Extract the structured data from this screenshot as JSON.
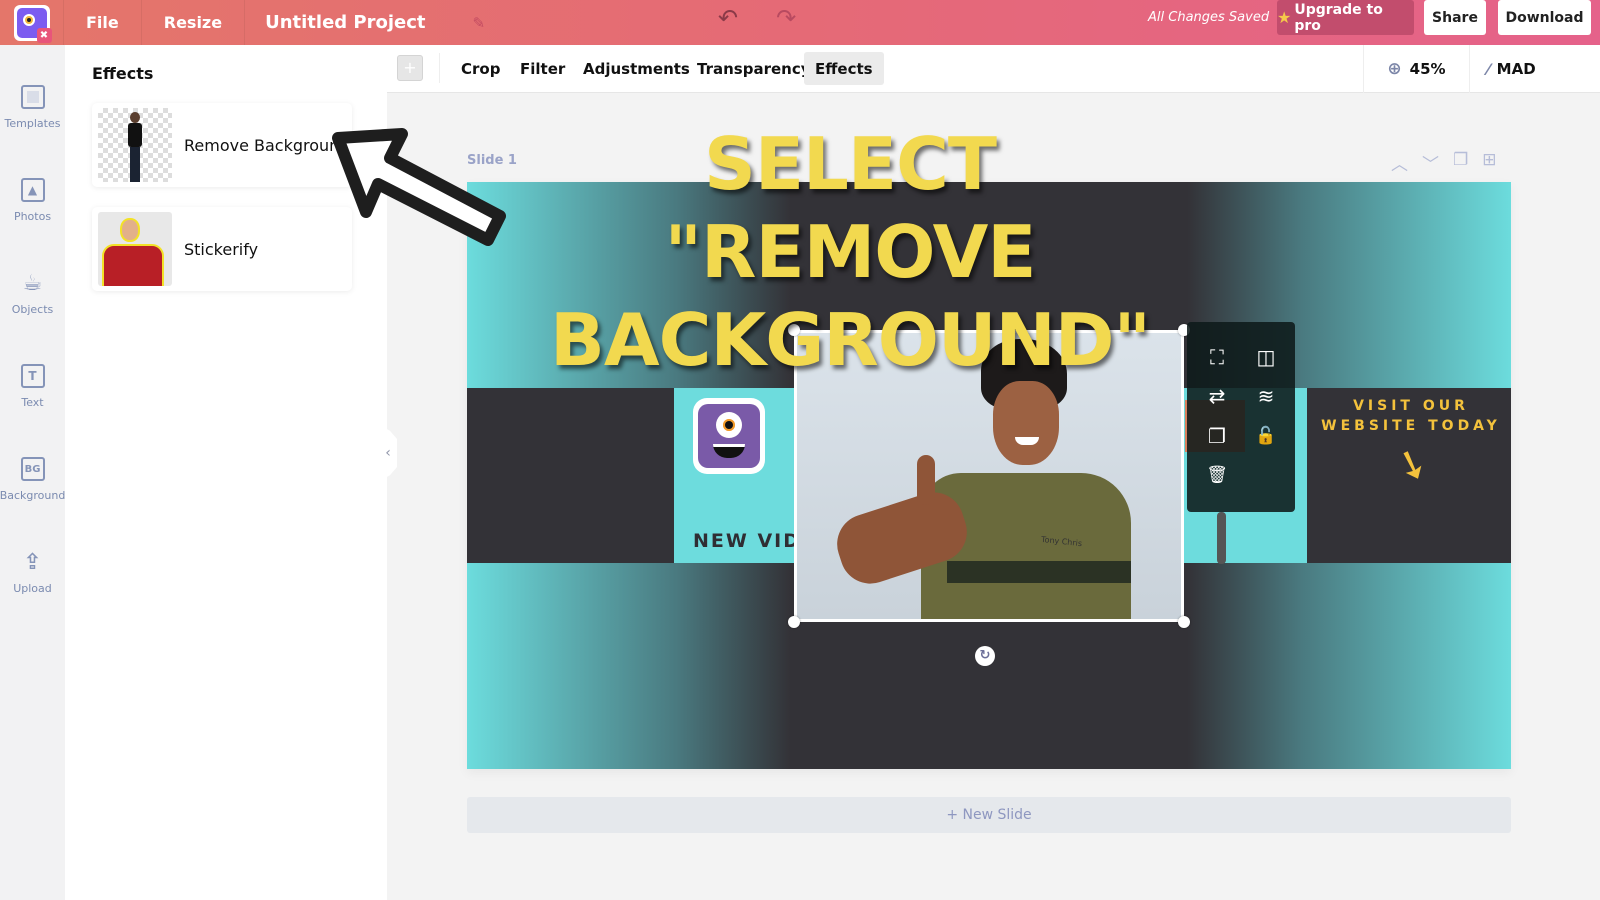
{
  "header": {
    "logo": "app-logo",
    "menu": [
      "File",
      "Resize"
    ],
    "project_title": "Untitled Project",
    "save_status": "All Changes Saved",
    "upgrade_label": "Upgrade to pro",
    "share_label": "Share",
    "download_label": "Download",
    "icons": {
      "undo": "↶",
      "redo": "↷",
      "edit": "✎",
      "star": "★"
    }
  },
  "rail": {
    "items": [
      {
        "label": "Templates",
        "icon": "template-icon"
      },
      {
        "label": "Photos",
        "icon": "photo-icon"
      },
      {
        "label": "Objects",
        "icon": "cup-icon"
      },
      {
        "label": "Text",
        "icon": "text-icon",
        "glyph": "T"
      },
      {
        "label": "Background",
        "icon": "background-icon",
        "glyph": "BG"
      },
      {
        "label": "Upload",
        "icon": "upload-icon",
        "glyph": "⇪"
      }
    ]
  },
  "panel": {
    "title": "Effects",
    "effects": [
      {
        "label": "Remove Background"
      },
      {
        "label": "Stickerify"
      }
    ],
    "collapse_glyph": "‹"
  },
  "toolbar": {
    "add_glyph": "+",
    "tabs": [
      "Crop",
      "Filter",
      "Adjustments",
      "Transparency",
      "Effects"
    ],
    "active_tab": "Effects",
    "zoom_level": "45%",
    "zoom_glyph": "⊕",
    "magic_label": "MAD",
    "magic_glyph": "⚡"
  },
  "slide": {
    "label": "Slide 1",
    "tools": [
      "︿",
      "﹀",
      "❐",
      "⊞"
    ],
    "new_video_text": "NEW VIDE",
    "visit_text": "VISIT OUR WEBSITE TODAY",
    "visit_arrow": "➘",
    "shirt_text": "Tony Chris",
    "rotate_glyph": "↻",
    "floating_tools": [
      {
        "name": "crop-icon",
        "glyph": "⛶"
      },
      {
        "name": "flip-icon",
        "glyph": "◫"
      },
      {
        "name": "replace-icon",
        "glyph": "⇄"
      },
      {
        "name": "layers-icon",
        "glyph": "≋"
      },
      {
        "name": "duplicate-icon",
        "glyph": "❐"
      },
      {
        "name": "unlock-icon",
        "glyph": "🔓"
      },
      {
        "name": "trash-icon",
        "glyph": "🗑"
      }
    ]
  },
  "new_slide_label": "+ New Slide",
  "annotation": {
    "line1": "SELECT \"REMOVE",
    "line2": "BACKGROUND\""
  },
  "colors": {
    "header_start": "#e4766a",
    "header_end": "#e5628a",
    "teal": "#6ddcdd",
    "dark": "#333237",
    "annotation_yellow": "#f2d94f",
    "visit_yellow": "#f4c23c"
  }
}
